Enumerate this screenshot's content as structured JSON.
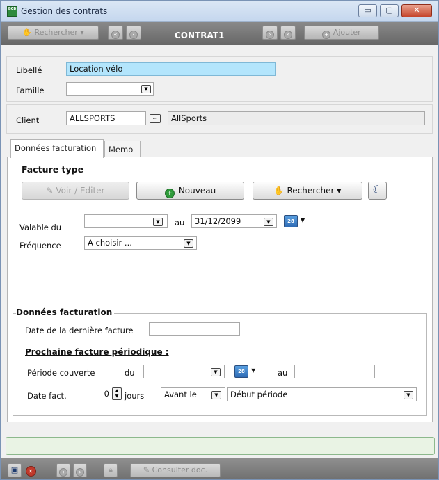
{
  "window": {
    "title": "Gestion des contrats",
    "minimize": "▭",
    "maximize": "▢",
    "close": "✕",
    "logo_text": "BCB"
  },
  "toolbar": {
    "search_label": "Rechercher",
    "title": "CONTRAT1",
    "add_label": "Ajouter"
  },
  "header": {
    "libelle_label": "Libellé",
    "libelle_value": "Location vélo",
    "famille_label": "Famille",
    "famille_value": "",
    "client_label": "Client",
    "client_code": "ALLSPORTS",
    "client_name": "AllSports",
    "client_browse": "..."
  },
  "tabs": [
    {
      "label": "Données facturation",
      "active": true
    },
    {
      "label": "Memo",
      "active": false
    }
  ],
  "facture_type": {
    "heading": "Facture type",
    "view_edit_label": "Voir / Editer",
    "new_label": "Nouveau",
    "search_label": "Rechercher"
  },
  "validity": {
    "valable_du_label": "Valable du",
    "valable_du_value": "",
    "au_label": "au",
    "au_value": "31/12/2099",
    "frequence_label": "Fréquence",
    "frequence_value": "A choisir ..."
  },
  "billing_group": {
    "title": "Données facturation",
    "last_invoice_label": "Date de la dernière facture",
    "last_invoice_value": "",
    "next_invoice_heading": "Prochaine facture périodique :",
    "period_label": "Période couverte",
    "du_label": "du",
    "du_value": "",
    "au_label": "au",
    "au_value": "",
    "date_fact_label": "Date fact.",
    "days_value": "0",
    "days_label": "jours",
    "relation_value": "Avant le",
    "reference_value": "Début période"
  },
  "bottombar": {
    "consult_label": "Consulter doc."
  },
  "colors": {
    "accent_field": "#b3e5fc",
    "status_bg": "#e9f3e4",
    "toolbar_bg": "#7a7a7a"
  }
}
